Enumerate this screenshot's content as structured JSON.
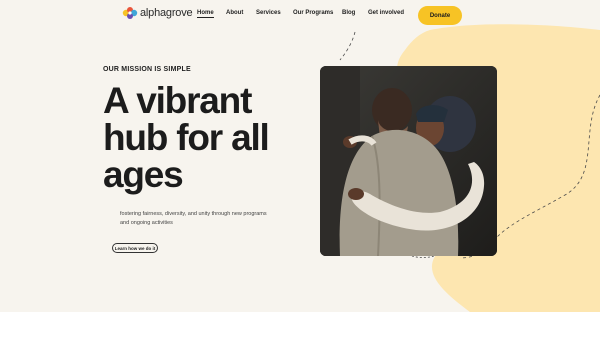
{
  "brand": {
    "name": "alphagrove",
    "logo_icon": "people-cluster-logo",
    "colors": {
      "accent": "#f7c325",
      "blob": "#fde6b0",
      "background": "#f7f4ee",
      "text": "#1c1c1c"
    }
  },
  "nav": {
    "items": [
      {
        "label": "Home",
        "active": true
      },
      {
        "label": "About",
        "active": false
      },
      {
        "label": "Services",
        "active": false
      },
      {
        "label": "Our Programs",
        "active": false
      },
      {
        "label": "Blog",
        "active": false
      },
      {
        "label": "Get involved",
        "active": false
      }
    ],
    "donate_label": "Donate"
  },
  "hero": {
    "eyebrow": "OUR MISSION IS SIMPLE",
    "headline": "A vibrant hub for all ages",
    "subtext": "fostering fairness, diversity, and unity through new programs and ongoing activities",
    "cta_label": "Learn how we do it",
    "image_subject": "two people embracing"
  }
}
